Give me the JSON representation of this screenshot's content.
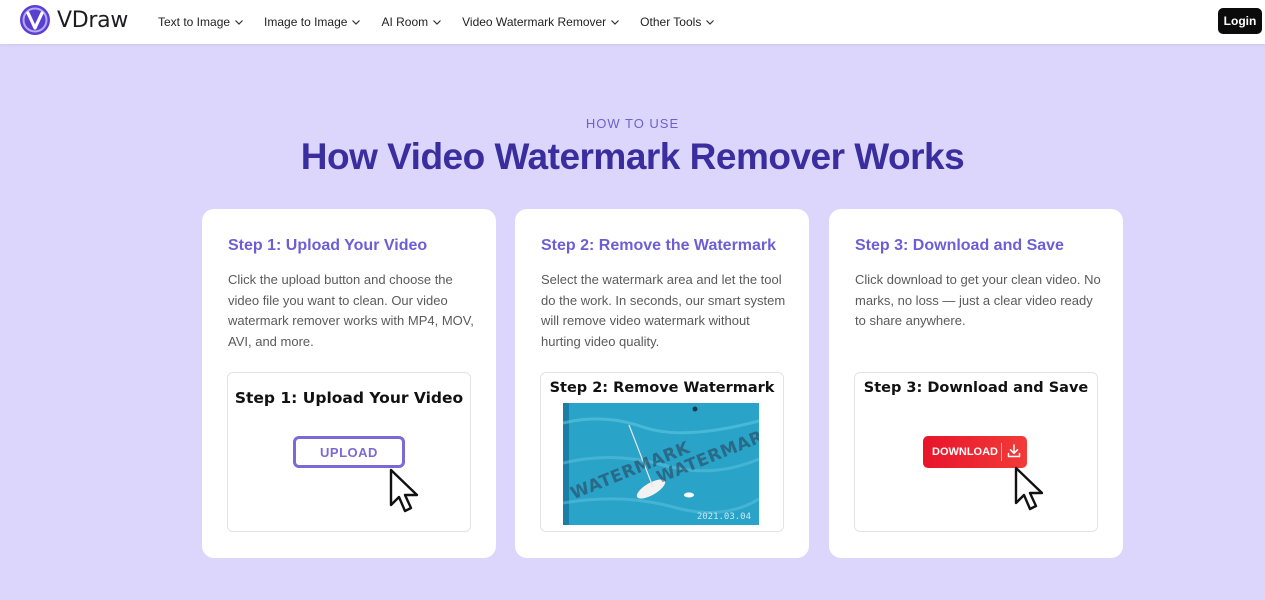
{
  "nav": {
    "brand": "VDraw",
    "items": [
      {
        "label": "Text to Image"
      },
      {
        "label": "Image to Image"
      },
      {
        "label": "AI Room"
      },
      {
        "label": "Video Watermark Remover"
      },
      {
        "label": "Other Tools"
      }
    ],
    "login_label": "Login"
  },
  "hero": {
    "eyebrow": "HOW TO USE",
    "title": "How Video Watermark Remover Works"
  },
  "steps": [
    {
      "title": "Step 1: Upload Your Video",
      "description": "Click the upload button and choose the video file you want to clean. Our video watermark remover works with MP4, MOV, AVI, and more.",
      "illustration_title": "Step 1: Upload Your Video",
      "button_label": "UPLOAD"
    },
    {
      "title": "Step 2: Remove the Watermark",
      "description": "Select the watermark area and let the tool do the work. In seconds, our smart system will remove video watermark without hurting video quality.",
      "illustration_title": "Step 2: Remove Watermark",
      "watermark_text_1": "WATERMARK",
      "watermark_text_2": "WATERMARK",
      "date_stamp": "2021.03.04"
    },
    {
      "title": "Step 3: Download and Save",
      "description": "Click download to get your clean video. No marks, no loss — just a clear video ready to share anywhere.",
      "illustration_title": "Step 3: Download and Save",
      "button_label": "DOWNLOAD"
    }
  ],
  "colors": {
    "background": "#dcd6fc",
    "heading": "#3a2e9e",
    "accent": "#6c5fd6",
    "download_red": "#e8142b"
  },
  "icons": [
    "vdraw-logo-icon",
    "chevron-down-icon",
    "cursor-arrow-icon",
    "download-arrow-icon"
  ]
}
